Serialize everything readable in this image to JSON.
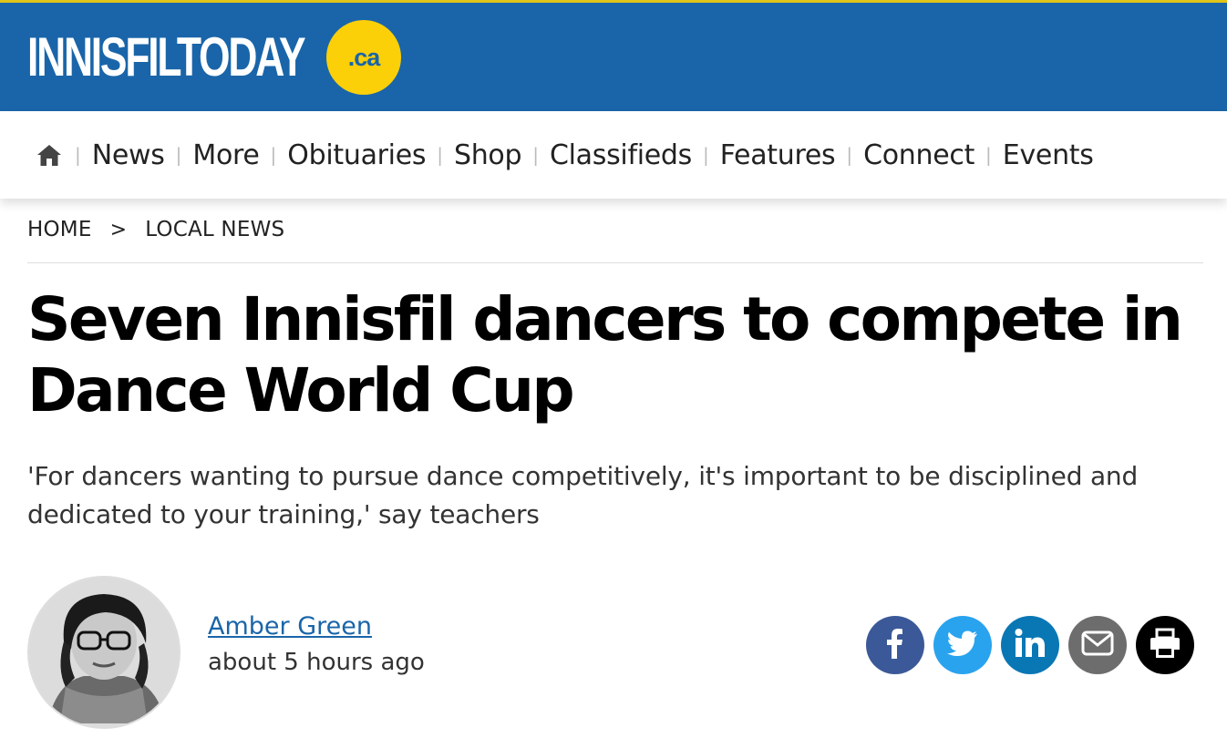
{
  "site": {
    "logo_text": "INNISFILTODAY",
    "logo_suffix": ".ca",
    "colors": {
      "header_blue": "#1a65a9",
      "logo_yellow": "#fcd008",
      "top_stripe": "#e0c419"
    }
  },
  "nav": {
    "home_icon": "home-icon",
    "items": [
      {
        "label": "News"
      },
      {
        "label": "More"
      },
      {
        "label": "Obituaries"
      },
      {
        "label": "Shop"
      },
      {
        "label": "Classifieds"
      },
      {
        "label": "Features"
      },
      {
        "label": "Connect"
      },
      {
        "label": "Events"
      }
    ],
    "separator": "|"
  },
  "breadcrumb": {
    "home": "HOME",
    "separator": ">",
    "section": "LOCAL NEWS"
  },
  "article": {
    "headline": "Seven Innisfil dancers to compete in Dance World Cup",
    "subhead": "'For dancers wanting to pursue dance competitively, it's important to be disciplined and dedicated to your training,' say teachers",
    "author": "Amber Green",
    "timestamp": "about 5 hours ago"
  },
  "share": [
    {
      "icon": "facebook-icon",
      "color": "#3b5998"
    },
    {
      "icon": "twitter-icon",
      "color": "#2aa3ef"
    },
    {
      "icon": "linkedin-icon",
      "color": "#0a77b5"
    },
    {
      "icon": "email-icon",
      "color": "#6d6d6d"
    },
    {
      "icon": "print-icon",
      "color": "#000000"
    }
  ]
}
